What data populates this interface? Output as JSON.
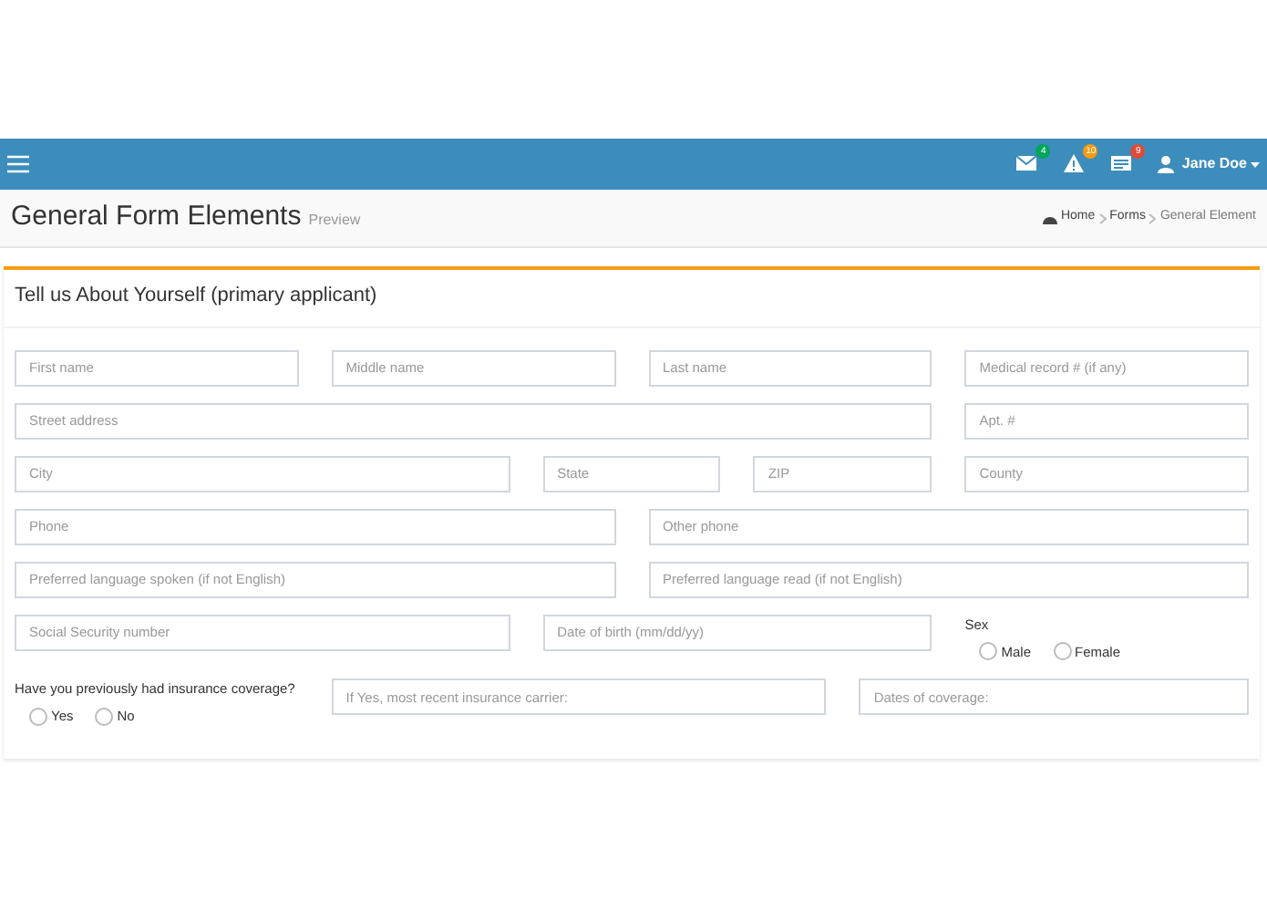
{
  "navbar": {
    "notifications": [
      {
        "kind": "mail",
        "count": "4",
        "color": "#00a65a"
      },
      {
        "kind": "warning",
        "count": "10",
        "color": "#f39c12"
      },
      {
        "kind": "tasks",
        "count": "9",
        "color": "#dd4b39"
      }
    ],
    "user": "Jane Doe"
  },
  "header": {
    "title": "General Form Elements",
    "subtitle": "Preview",
    "breadcrumbs": [
      "Home",
      "Forms",
      "General Element"
    ]
  },
  "card": {
    "title": "Tell us About Yourself (primary applicant)",
    "sections": [
      [
        {
          "kind": "input",
          "placeholder": "First name"
        },
        {
          "kind": "input",
          "placeholder": "Middle name"
        },
        {
          "kind": "input",
          "placeholder": "Last name"
        },
        {
          "kind": "input",
          "placeholder": "Medical record # (if any)"
        }
      ],
      [
        {
          "kind": "input",
          "placeholder": "Street address"
        },
        {
          "kind": "input",
          "placeholder": "Apt. #"
        }
      ],
      [
        {
          "kind": "input",
          "placeholder": "City"
        },
        {
          "kind": "input",
          "placeholder": "State"
        },
        {
          "kind": "input",
          "placeholder": "ZIP"
        },
        {
          "kind": "input",
          "placeholder": "County"
        }
      ],
      [
        {
          "kind": "input",
          "placeholder": "Phone"
        },
        {
          "kind": "input",
          "placeholder": "Other phone"
        }
      ],
      [
        {
          "kind": "input",
          "placeholder": "Preferred language spoken (if not English)"
        },
        {
          "kind": "input",
          "placeholder": "Preferred language read (if not English)"
        }
      ],
      [
        {
          "kind": "input",
          "placeholder": "Social Security number"
        },
        {
          "kind": "input",
          "placeholder": "Date of birth (mm/dd/yy)"
        },
        {
          "kind": "radio",
          "label": "Sex",
          "options": [
            {
              "label": "Male",
              "selected": false
            },
            {
              "label": "Female",
              "selected": false
            }
          ]
        }
      ],
      [
        {
          "kind": "radio",
          "label": "Have you previously had insurance coverage?",
          "options": [
            {
              "label": "Yes",
              "selected": false
            },
            {
              "label": "No",
              "selected": false
            }
          ]
        },
        {
          "kind": "input",
          "placeholder": "If Yes, most recent insurance carrier:"
        },
        {
          "kind": "input",
          "placeholder": "Dates of coverage:"
        }
      ]
    ]
  }
}
